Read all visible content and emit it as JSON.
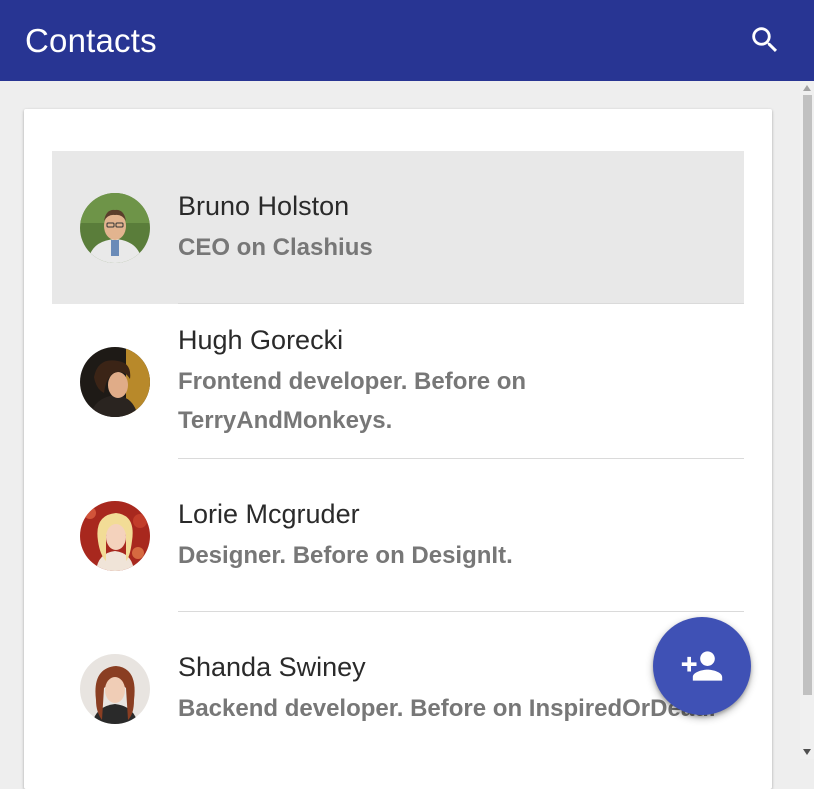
{
  "app_bar": {
    "title": "Contacts",
    "background": "#283593",
    "search_icon": "search-icon"
  },
  "contacts": [
    {
      "name": "Bruno Holston",
      "subtitle": "CEO on Clashius",
      "selected": true
    },
    {
      "name": "Hugh Gorecki",
      "subtitle": "Frontend developer. Before on TerryAndMonkeys.",
      "selected": false
    },
    {
      "name": "Lorie Mcgruder",
      "subtitle": "Designer. Before on DesignIt.",
      "selected": false
    },
    {
      "name": "Shanda Swiney",
      "subtitle": "Backend developer. Before on InspiredOrDead.",
      "selected": false
    }
  ],
  "fab": {
    "icon": "person-add-icon",
    "color": "#3f51b5"
  }
}
